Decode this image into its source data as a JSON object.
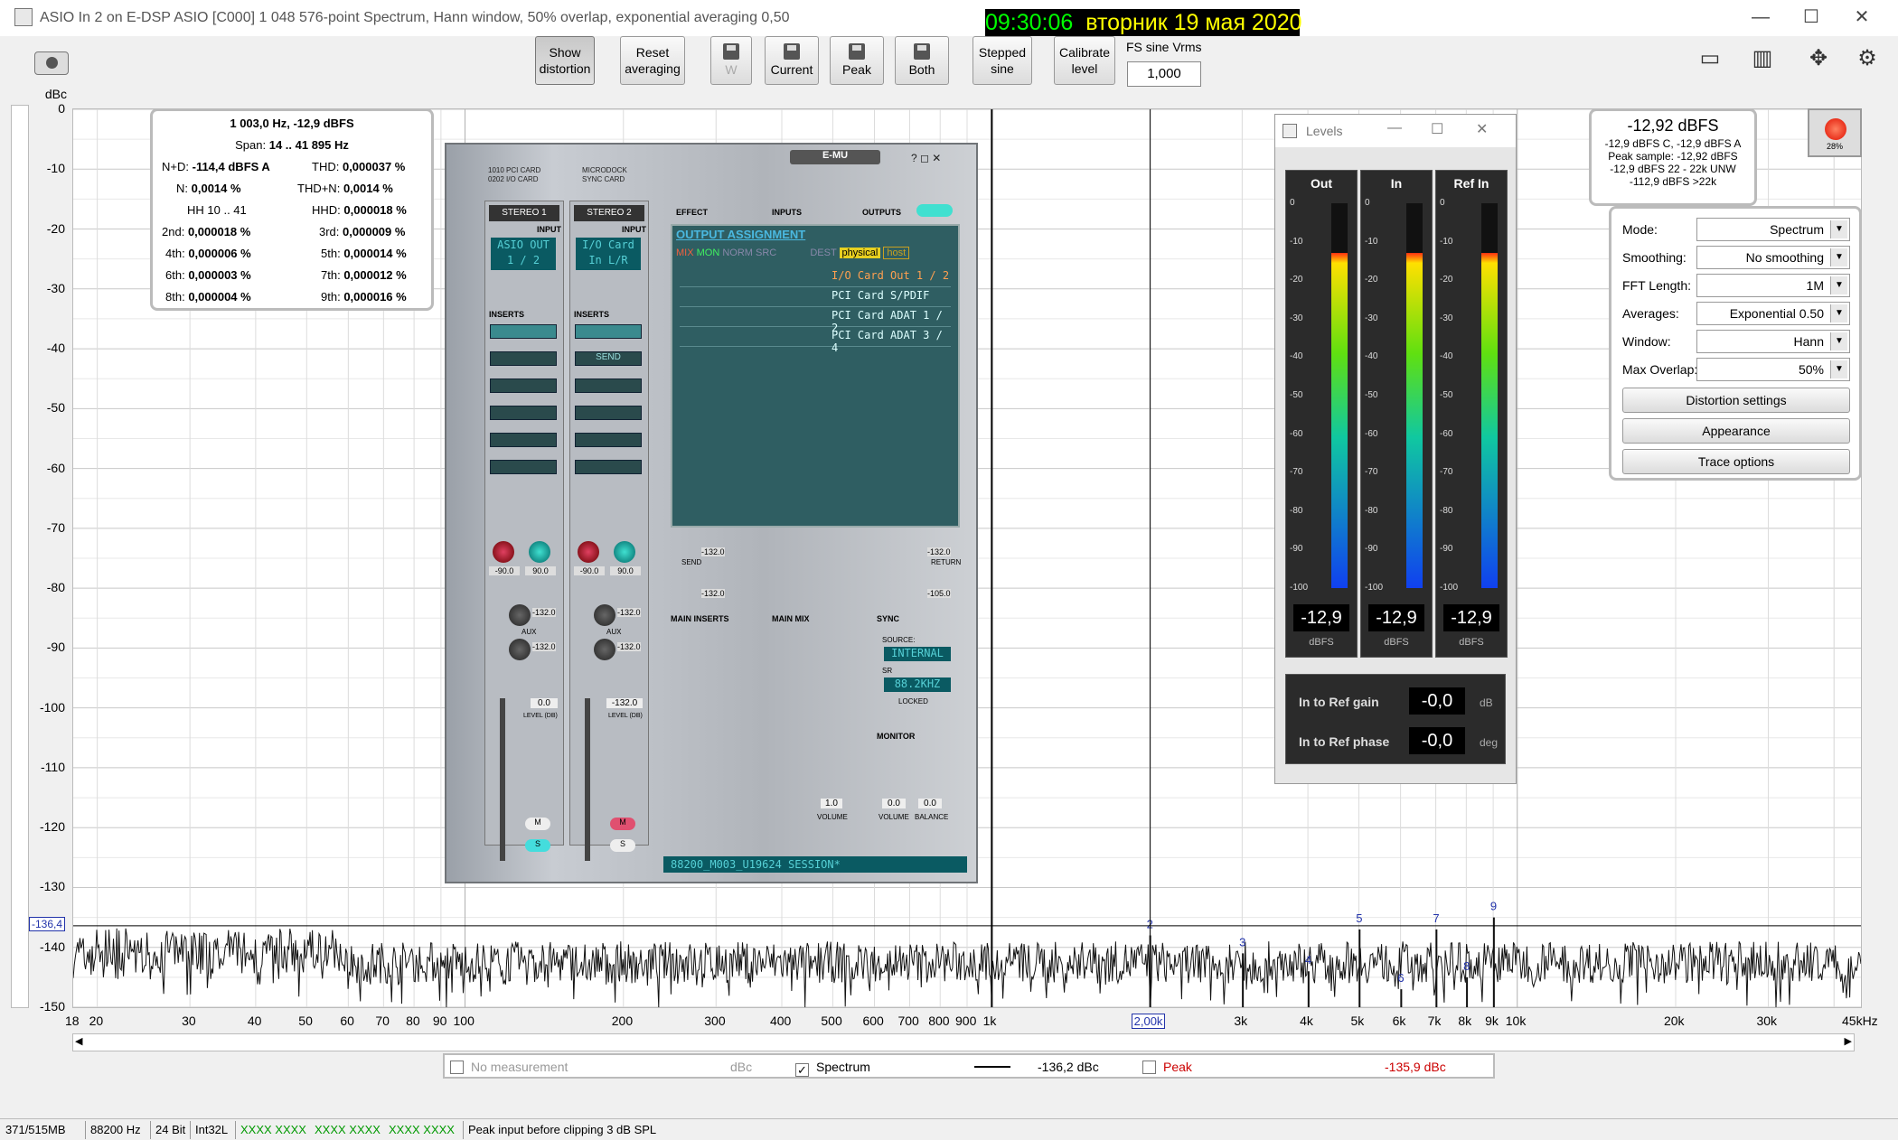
{
  "window": {
    "title": "ASIO In 2 on E-DSP ASIO [C000] 1 048 576-point Spectrum, Hann window, 50% overlap, exponential averaging 0,50",
    "clock_time": "09:30:06",
    "clock_date": "вторник 19 мая 2020"
  },
  "toolbar": {
    "show_distortion": "Show distortion",
    "reset_averaging": "Reset averaging",
    "w_label": "W",
    "current": "Current",
    "peak": "Peak",
    "both": "Both",
    "stepped_sine": "Stepped sine",
    "calibrate_level": "Calibrate level",
    "fs_label": "FS sine Vrms",
    "fs_value": "1,000"
  },
  "plot": {
    "y_unit": "dBc",
    "y_ticks": [
      "0",
      "-10",
      "-20",
      "-30",
      "-40",
      "-50",
      "-60",
      "-70",
      "-80",
      "-90",
      "-100",
      "-110",
      "-120",
      "-130",
      "-140",
      "-150"
    ],
    "x_ticks": [
      "18",
      "20",
      "30",
      "40",
      "50",
      "60",
      "70",
      "80",
      "90",
      "100",
      "200",
      "300",
      "400",
      "500",
      "600",
      "700",
      "800",
      "900",
      "1k",
      "3k",
      "4k",
      "5k",
      "6k",
      "7k",
      "8k",
      "9k",
      "10k",
      "20k",
      "30k",
      "45kHz"
    ],
    "cursor_freq_label": "2,00k",
    "cursor_level_label": "-136,4",
    "harmonic_labels": [
      "2",
      "3",
      "4",
      "5",
      "6",
      "7",
      "8",
      "9"
    ]
  },
  "chart_data": {
    "type": "line",
    "xlabel": "",
    "ylabel": "dBc",
    "x_scale": "log",
    "xlim": [
      18,
      45000
    ],
    "ylim": [
      -150,
      0
    ],
    "series": [
      {
        "name": "Spectrum",
        "points": [
          [
            18,
            -143
          ],
          [
            30,
            -145
          ],
          [
            50,
            -143
          ],
          [
            100,
            -144
          ],
          [
            200,
            -145
          ],
          [
            500,
            -145
          ],
          [
            900,
            -143
          ],
          [
            1003,
            0
          ],
          [
            1100,
            -143
          ],
          [
            2006,
            -138
          ],
          [
            3009,
            -141
          ],
          [
            4012,
            -144
          ],
          [
            5015,
            -137
          ],
          [
            6018,
            -147
          ],
          [
            7021,
            -137
          ],
          [
            8024,
            -145
          ],
          [
            9027,
            -135
          ],
          [
            20000,
            -145
          ],
          [
            45000,
            -143
          ]
        ]
      }
    ],
    "peaks": [
      {
        "label": "1k",
        "freq": 1003,
        "level": 0
      },
      {
        "label": "2",
        "freq": 2006,
        "level": -138
      },
      {
        "label": "3",
        "freq": 3009,
        "level": -141
      },
      {
        "label": "4",
        "freq": 4012,
        "level": -144
      },
      {
        "label": "5",
        "freq": 5015,
        "level": -137
      },
      {
        "label": "6",
        "freq": 6018,
        "level": -147
      },
      {
        "label": "7",
        "freq": 7021,
        "level": -137
      },
      {
        "label": "8",
        "freq": 8024,
        "level": -145
      },
      {
        "label": "9",
        "freq": 9027,
        "level": -135
      }
    ],
    "grid": true
  },
  "infobox": {
    "line1": "1 003,0 Hz, -12,9 dBFS",
    "span_label": "Span:",
    "span_value": "14 .. 41 895 Hz",
    "nd_label": "N+D:",
    "nd_value": "-114,4 dBFS A",
    "thd_label": "THD:",
    "thd_value": "0,000037 %",
    "n_label": "N:",
    "n_value": "0,0014 %",
    "thdn_label": "THD+N:",
    "thdn_value": "0,0014 %",
    "hh_label": "HH 10 .. 41",
    "hhd_label": "HHD:",
    "hhd_value": "0,000018 %",
    "h2_label": "2nd:",
    "h2_value": "0,000018 %",
    "h3_label": "3rd:",
    "h3_value": "0,000009 %",
    "h4_label": "4th:",
    "h4_value": "0,000006 %",
    "h5_label": "5th:",
    "h5_value": "0,000014 %",
    "h6_label": "6th:",
    "h6_value": "0,000003 %",
    "h7_label": "7th:",
    "h7_value": "0,000012 %",
    "h8_label": "8th:",
    "h8_value": "0,000004 %",
    "h9_label": "9th:",
    "h9_value": "0,000016 %"
  },
  "emu": {
    "logo": "E-MU",
    "card1": "1010 PCI CARD",
    "card2": "0202 I/O CARD",
    "dock1": "MICRODOCK",
    "dock2": "SYNC CARD",
    "stereo1": "STEREO 1",
    "stereo2": "STEREO 2",
    "input": "INPUT",
    "input1_disp": "ASIO OUT 1 / 2",
    "input2_disp": "I/O Card In L/R",
    "inserts": "INSERTS",
    "send": "SEND",
    "pan1": "-90.0",
    "pan2": "90.0",
    "pan3": "-90.0",
    "pan4": "90.0",
    "aux": "AUX",
    "aux_val": "-132.0",
    "level1": "0.0",
    "level2": "-132.0",
    "level_db": "LEVEL (DB)",
    "effect": "EFFECT",
    "inputs": "INPUTS",
    "outputs": "OUTPUTS",
    "output_assignment": "OUTPUT ASSIGNMENT",
    "mix": "MIX",
    "mon": "MON",
    "norm": "NORM",
    "src": "SRC",
    "dest": "DEST",
    "physical": "physical",
    "host": "host",
    "routes": [
      "I/O Card Out 1 / 2",
      "PCI Card S/PDIF",
      "PCI Card ADAT 1 / 2",
      "PCI Card ADAT 3 / 4"
    ],
    "send_val": "-132.0",
    "return_val": "-132.0",
    "return_val2": "-105.0",
    "send_label": "SEND",
    "return_label": "RETURN",
    "main_inserts": "MAIN INSERTS",
    "main_mix": "MAIN MIX",
    "sync": "SYNC",
    "source": "SOURCE:",
    "internal": "INTERNAL",
    "sr": "SR",
    "sr_val": "88.2KHZ",
    "locked": "LOCKED",
    "monitor": "MONITOR",
    "volume": "VOLUME",
    "balance": "BALANCE",
    "vol_val": "1.0",
    "mon_vol": "0.0",
    "mon_bal": "0.0",
    "session": "88200_M003_U19624 SESSION*"
  },
  "levels": {
    "title": "Levels",
    "meters": [
      {
        "name": "Out",
        "value": "-12,9",
        "unit": "dBFS",
        "level_db": -12.9
      },
      {
        "name": "In",
        "value": "-12,9",
        "unit": "dBFS",
        "level_db": -12.9
      },
      {
        "name": "Ref In",
        "value": "-12,9",
        "unit": "dBFS",
        "level_db": -12.9
      }
    ],
    "scale": [
      "0",
      "-10",
      "-20",
      "-30",
      "-40",
      "-50",
      "-60",
      "-70",
      "-80",
      "-90",
      "-100"
    ],
    "ref_gain_label": "In to Ref gain",
    "ref_gain_value": "-0,0",
    "ref_gain_unit": "dB",
    "ref_phase_label": "In to Ref phase",
    "ref_phase_value": "-0,0",
    "ref_phase_unit": "deg"
  },
  "readout": {
    "main": "-12,92 dBFS",
    "l1": "-12,9 dBFS C, -12,9 dBFS A",
    "l2": "Peak sample: -12,92 dBFS",
    "l3": "-12,9 dBFS 22 - 22k UNW",
    "l4": "-112,9 dBFS >22k"
  },
  "record": {
    "percent": "28%"
  },
  "settings": {
    "mode_label": "Mode:",
    "mode_value": "Spectrum",
    "smoothing_label": "Smoothing:",
    "smoothing_value": "No smoothing",
    "fft_label": "FFT Length:",
    "fft_value": "1M",
    "avg_label": "Averages:",
    "avg_value": "Exponential 0.50",
    "window_label": "Window:",
    "window_value": "Hann",
    "overlap_label": "Max Overlap:",
    "overlap_value": "50%",
    "distortion_btn": "Distortion settings",
    "appearance_btn": "Appearance",
    "trace_btn": "Trace options"
  },
  "legend": {
    "no_measurement": "No measurement",
    "unit": "dBc",
    "spectrum": "Spectrum",
    "spectrum_value": "-136,2 dBc",
    "peak": "Peak",
    "peak_value": "-135,9 dBc"
  },
  "status": {
    "memory": "371/515MB",
    "rate": "88200 Hz",
    "bits": "24 Bit",
    "format": "Int32L",
    "pattern1": "XXXX XXXX",
    "pattern2": "XXXX XXXX",
    "pattern3": "XXXX XXXX",
    "message": "Peak input before clipping 3 dB SPL"
  },
  "colors": {
    "accent": "#00ff00",
    "clock_date": "#ffff00",
    "harmonic_label": "#2233aa",
    "peak_legend": "#cc0000"
  }
}
